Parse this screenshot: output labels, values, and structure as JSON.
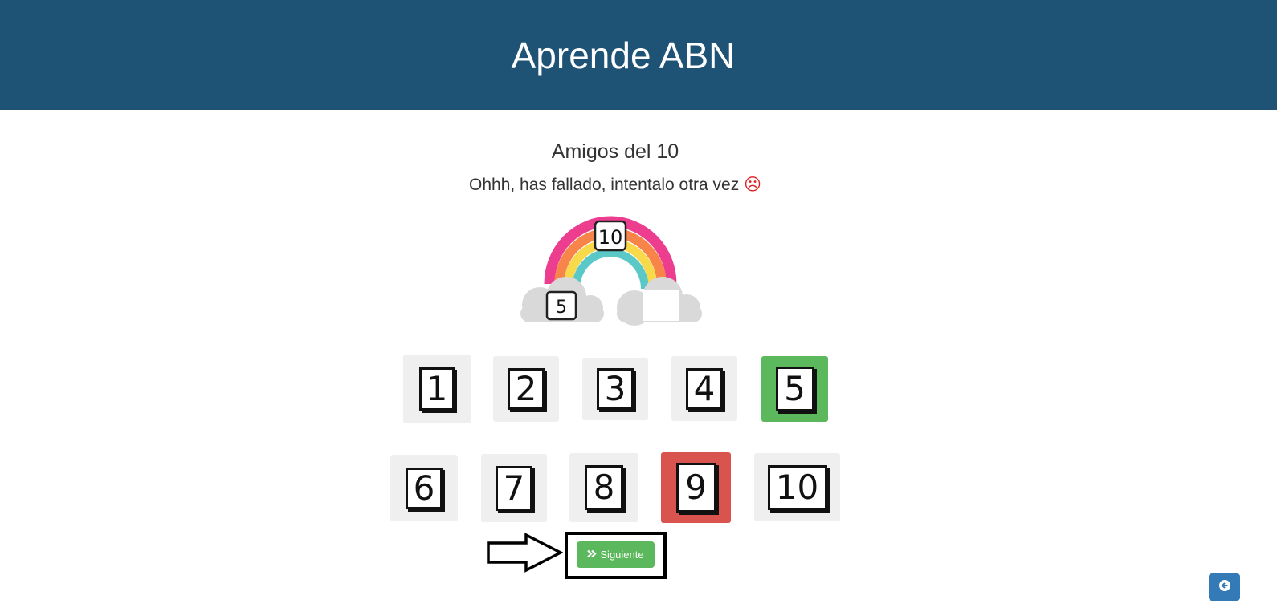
{
  "header": {
    "title": "Aprende ABN"
  },
  "exercise": {
    "title": "Amigos del 10",
    "feedback": "Ohhh, has fallado, intentalo otra vez",
    "feedback_icon": "sad-face-icon",
    "target": "10",
    "left_addend": "5",
    "right_addend": ""
  },
  "options": [
    {
      "label": "1",
      "state": "neutral"
    },
    {
      "label": "2",
      "state": "neutral"
    },
    {
      "label": "3",
      "state": "neutral"
    },
    {
      "label": "4",
      "state": "neutral"
    },
    {
      "label": "5",
      "state": "correct"
    },
    {
      "label": "6",
      "state": "neutral"
    },
    {
      "label": "7",
      "state": "neutral"
    },
    {
      "label": "8",
      "state": "neutral"
    },
    {
      "label": "9",
      "state": "wrong"
    },
    {
      "label": "10",
      "state": "neutral"
    }
  ],
  "next_button": {
    "label": "Siguiente",
    "icon": "double-chevron-right-icon"
  },
  "back_button": {
    "icon": "arrow-left-circle-icon"
  },
  "colors": {
    "header": "#1e5376",
    "correct": "#5cb85c",
    "wrong": "#d9534f",
    "neutral": "#efefef",
    "back": "#337ab7"
  }
}
